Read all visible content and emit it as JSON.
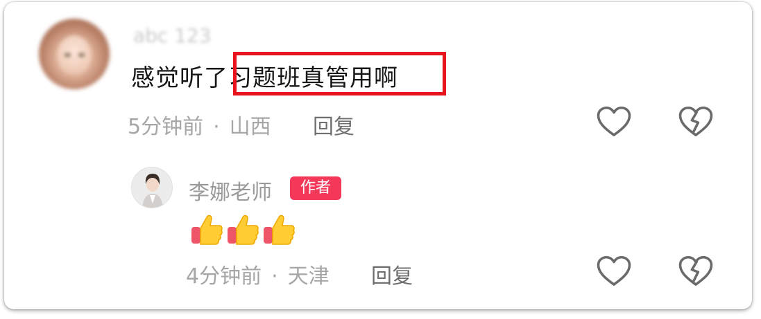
{
  "comment": {
    "username": "abc 123",
    "text": "感觉听了习题班真管用啊",
    "time": "5分钟前",
    "separator": "·",
    "location": "山西",
    "reply_label": "回复",
    "like_icon": "heart-outline-icon",
    "dislike_icon": "broken-heart-icon"
  },
  "reply": {
    "author": "李娜老师",
    "badge": "作者",
    "emoji": [
      "thumbs-up-emoji",
      "thumbs-up-emoji",
      "thumbs-up-emoji"
    ],
    "time": "4分钟前",
    "separator": "·",
    "location": "天津",
    "reply_label": "回复",
    "like_icon": "heart-outline-icon",
    "dislike_icon": "broken-heart-icon"
  },
  "colors": {
    "highlight_border": "#e8141b",
    "badge_bg": "#f3385a",
    "meta_text": "#a6a6a6",
    "main_text": "#161616"
  }
}
